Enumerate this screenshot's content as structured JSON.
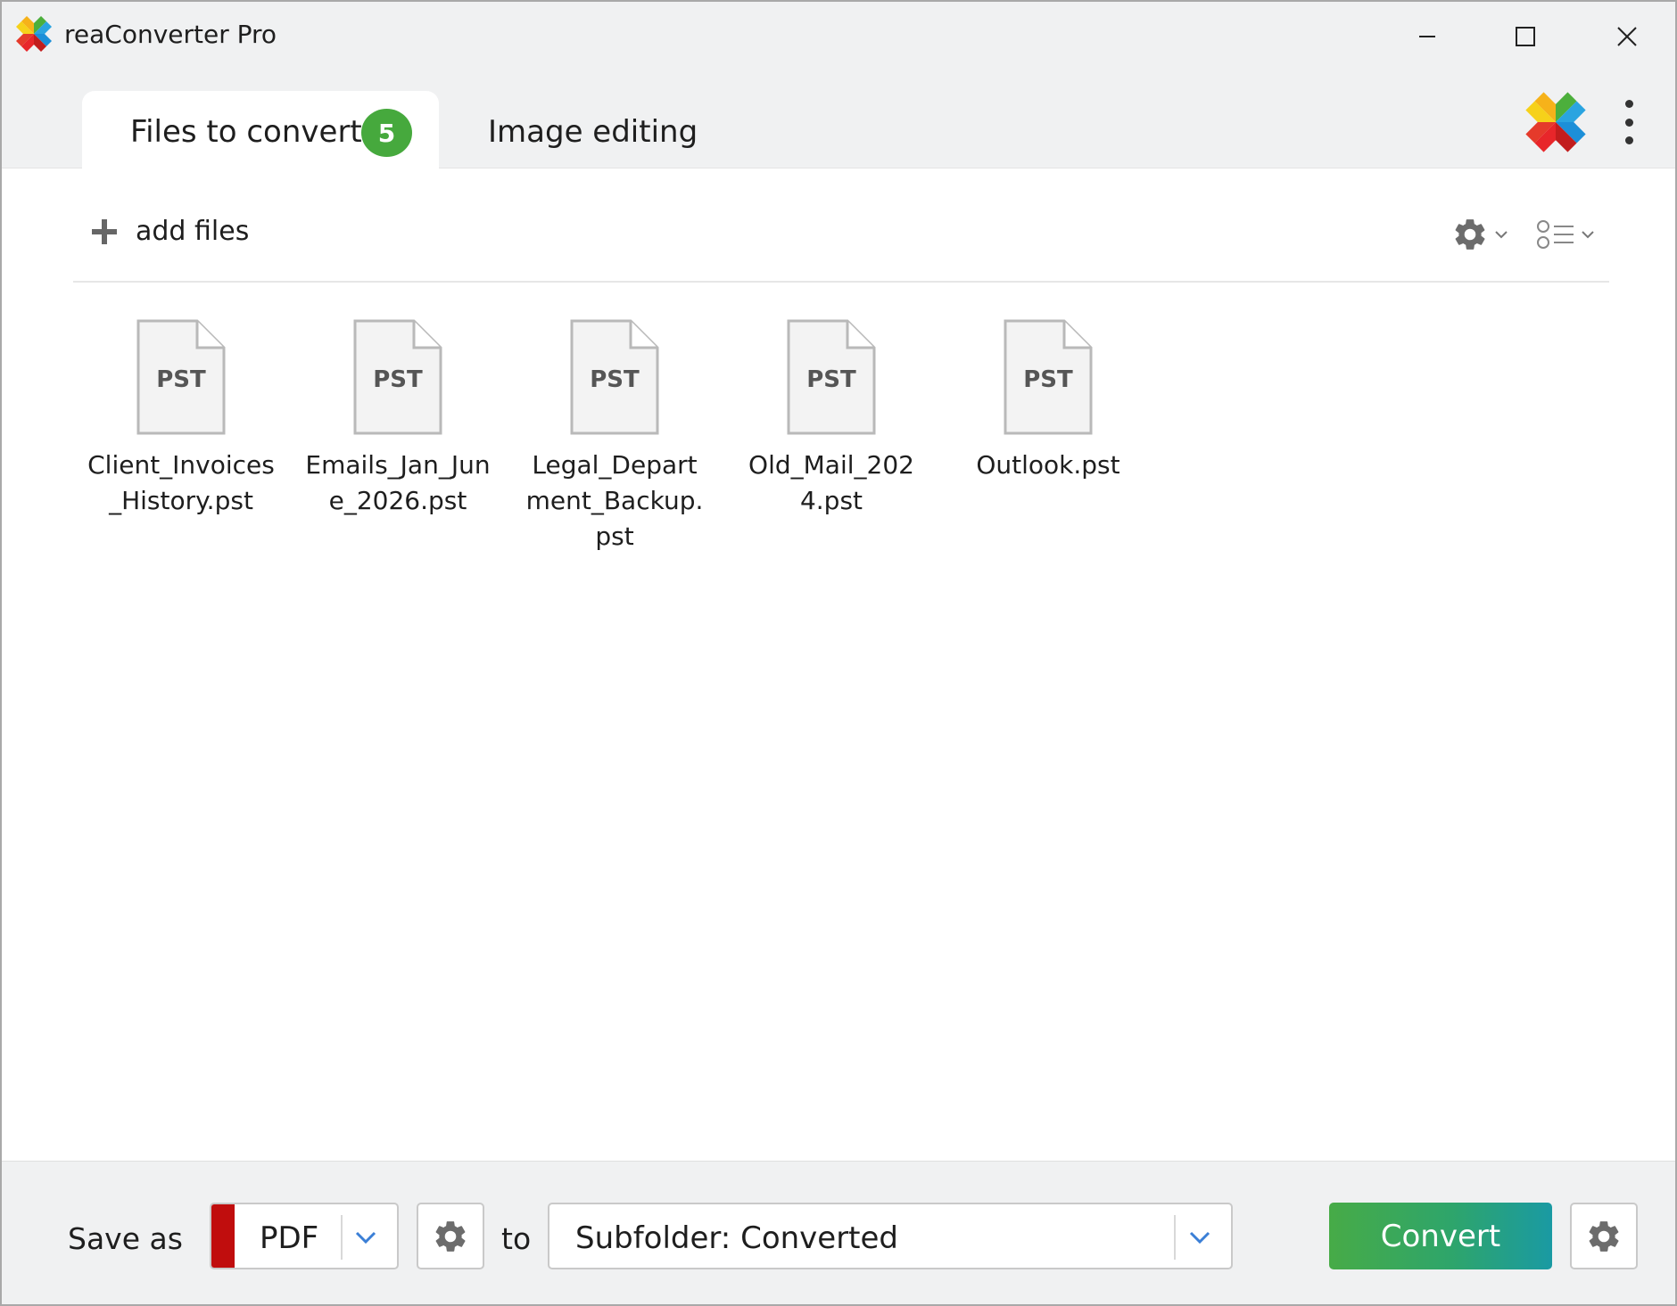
{
  "window": {
    "title": "reaConverter Pro",
    "controls": [
      "minimize",
      "maximize",
      "close"
    ]
  },
  "tabs": {
    "files": {
      "label": "Files to convert",
      "count": "5"
    },
    "image_editing": {
      "label": "Image editing"
    }
  },
  "toolbar": {
    "add_files_label": "add files",
    "icons": [
      "plus-icon",
      "gear-icon",
      "chevron-down-icon",
      "list-view-icon"
    ]
  },
  "files": [
    {
      "ext": "PST",
      "name": "Client_Invoices_History.pst"
    },
    {
      "ext": "PST",
      "name": "Emails_Jan_June_2026.pst"
    },
    {
      "ext": "PST",
      "name": "Legal_Department_Backup.pst"
    },
    {
      "ext": "PST",
      "name": "Old_Mail_2024.pst"
    },
    {
      "ext": "PST",
      "name": "Outlook.pst"
    }
  ],
  "footer": {
    "save_as_label": "Save as",
    "format": {
      "value": "PDF",
      "color": "#c00d0d"
    },
    "to_label": "to",
    "destination": "Subfolder: Converted",
    "convert_label": "Convert"
  },
  "colors": {
    "badge": "#46a93d",
    "convert_start": "#47ab47",
    "convert_end": "#1a9aa3",
    "chrome": "#f0f1f2"
  }
}
